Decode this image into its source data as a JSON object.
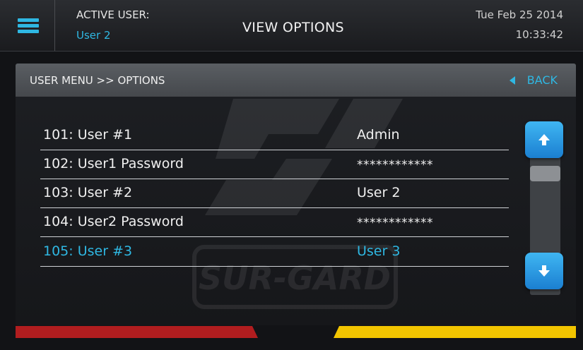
{
  "header": {
    "active_user_label": "ACTIVE USER:",
    "active_user_value": "User 2",
    "title": "VIEW OPTIONS",
    "date": "Tue Feb 25 2014",
    "time": "10:33:42"
  },
  "panel": {
    "breadcrumb": "USER MENU >> OPTIONS",
    "back_label": "BACK"
  },
  "options": [
    {
      "label": "101: User #1",
      "value": "Admin"
    },
    {
      "label": "102: User1 Password",
      "value": "************"
    },
    {
      "label": "103: User #2",
      "value": "User 2"
    },
    {
      "label": "104: User2 Password",
      "value": "************"
    },
    {
      "label": "105: User #3",
      "value": "User 3"
    }
  ],
  "watermark_text": "SUR-GARD",
  "colors": {
    "accent": "#2fb8e3",
    "button": "#2a8fe0",
    "status_red": "#b11d1f",
    "status_yellow": "#f2c500"
  },
  "icons": {
    "menu": "hamburger-icon",
    "back": "triangle-left-icon",
    "scroll_up": "arrow-up-icon",
    "scroll_down": "arrow-down-icon"
  }
}
